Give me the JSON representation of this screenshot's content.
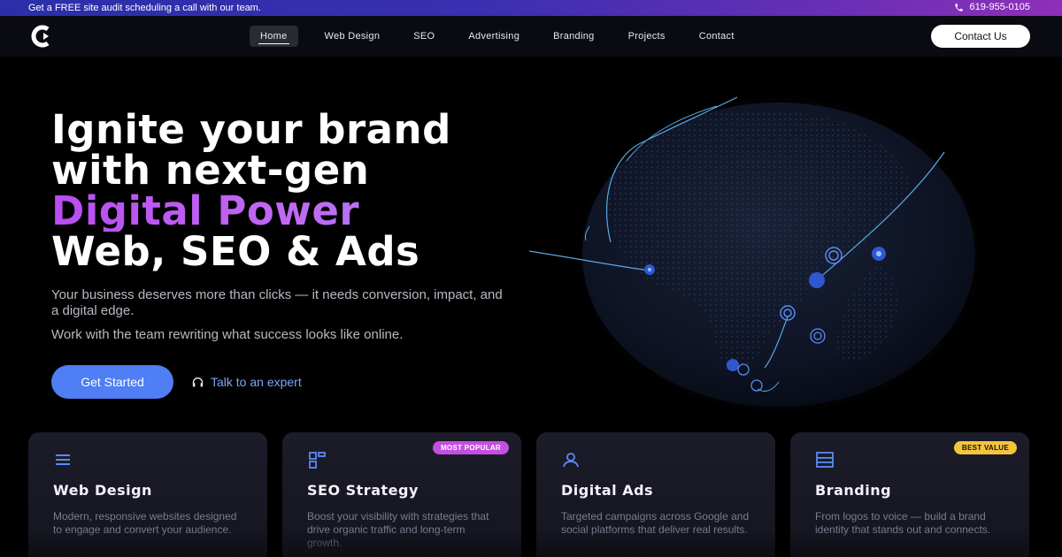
{
  "topbar": {
    "message": "Get a FREE site audit scheduling a call with our team.",
    "phone": "619-955-0105",
    "phone_icon": "phone-icon"
  },
  "nav": {
    "logo_icon": "c-logo-icon",
    "items": [
      {
        "label": "Home",
        "active": true
      },
      {
        "label": "Web Design"
      },
      {
        "label": "SEO"
      },
      {
        "label": "Advertising"
      },
      {
        "label": "Branding"
      },
      {
        "label": "Projects"
      },
      {
        "label": "Contact"
      }
    ],
    "cta_label": "Contact Us"
  },
  "hero": {
    "title_line1": "Ignite your brand",
    "title_line2": "with next-gen",
    "title_line3": "Digital Power",
    "title_line4": "Web, SEO & Ads",
    "subtitle": "Your business deserves more than clicks — it needs conversion, impact, and a digital edge.",
    "subtitle2": "Work with the team rewriting what success looks like online.",
    "primary_cta": "Get Started",
    "secondary_cta": "Talk to an expert",
    "secondary_icon": "headphones-icon"
  },
  "cards": [
    {
      "icon": "menu-lines-icon",
      "title": "Web Design",
      "desc": "Modern, responsive websites designed to engage and convert your audience.",
      "badge": ""
    },
    {
      "icon": "grid-squares-icon",
      "title": "SEO Strategy",
      "desc": "Boost your visibility with strategies that drive organic traffic and long-term growth.",
      "badge": "MOST POPULAR"
    },
    {
      "icon": "user-icon",
      "title": "Digital Ads",
      "desc": "Targeted campaigns across Google and social platforms that deliver real results.",
      "badge": ""
    },
    {
      "icon": "layers-icon",
      "title": "Branding",
      "desc": "From logos to voice — build a brand identity that stands out and connects.",
      "badge": "BEST VALUE"
    }
  ],
  "colors": {
    "accent_blue": "#4f7ef5",
    "accent_purple": "#b84df0",
    "badge_purple": "#c44fe0",
    "badge_yellow": "#f4c53c",
    "link_blue": "#7fa4ff"
  }
}
